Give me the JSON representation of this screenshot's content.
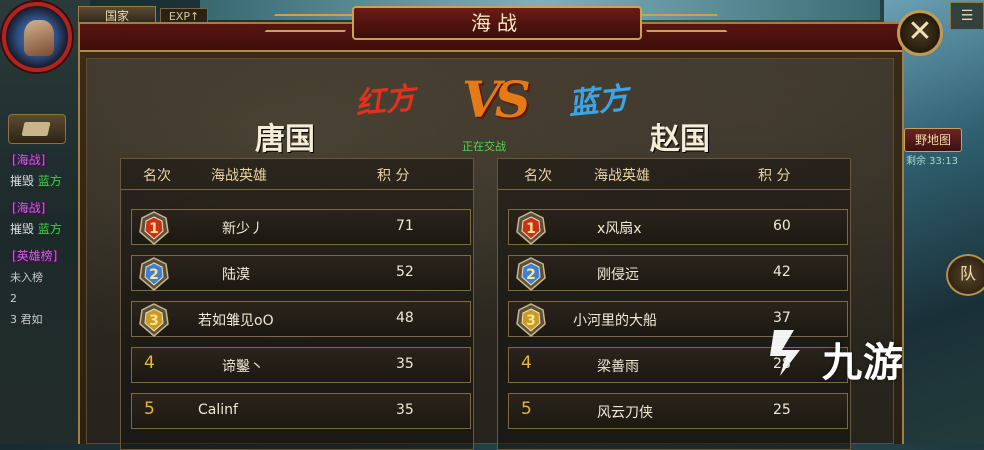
{
  "hud": {
    "tab_guojia": "国家",
    "tab_exp": "EXP↑",
    "map_button": "野地图",
    "map_sub": "剩余 33:13",
    "team_button": "队",
    "corner_button": "☰",
    "side_log": [
      {
        "tag": "[海战]",
        "text": "摧毁",
        "green": "蓝方"
      },
      {
        "tag": "[海战]",
        "text": "摧毁",
        "green": "蓝方"
      },
      {
        "tag": "[英雄榜]",
        "text": "",
        "green": ""
      }
    ],
    "side_small": [
      "未入榜",
      "2",
      "3  君如"
    ]
  },
  "window": {
    "title": "海战",
    "close_icon": "close-icon"
  },
  "battle": {
    "red_side": "红方",
    "vs": "VS",
    "blue_side": "蓝方",
    "status": "正在交战",
    "left_nation": "唐国",
    "right_nation": "赵国"
  },
  "columns": {
    "rank": "名次",
    "hero": "海战英雄",
    "score": "积 分"
  },
  "left_table": [
    {
      "rank": "1",
      "name": "新少丿",
      "score": "71"
    },
    {
      "rank": "2",
      "name": "陆漠",
      "score": "52"
    },
    {
      "rank": "3",
      "name": "若如雏见oO",
      "score": "48"
    },
    {
      "rank": "4",
      "name": "谛鑿丶",
      "score": "35"
    },
    {
      "rank": "5",
      "name": "Calinf",
      "score": "35"
    }
  ],
  "right_table": [
    {
      "rank": "1",
      "name": "x风扇x",
      "score": "60"
    },
    {
      "rank": "2",
      "name": "刚侵远",
      "score": "42"
    },
    {
      "rank": "3",
      "name": "小河里的大船",
      "score": "37"
    },
    {
      "rank": "4",
      "name": "梁善雨",
      "score": "28"
    },
    {
      "rank": "5",
      "name": "风云刀侠",
      "score": "25"
    }
  ],
  "watermark": "九游"
}
